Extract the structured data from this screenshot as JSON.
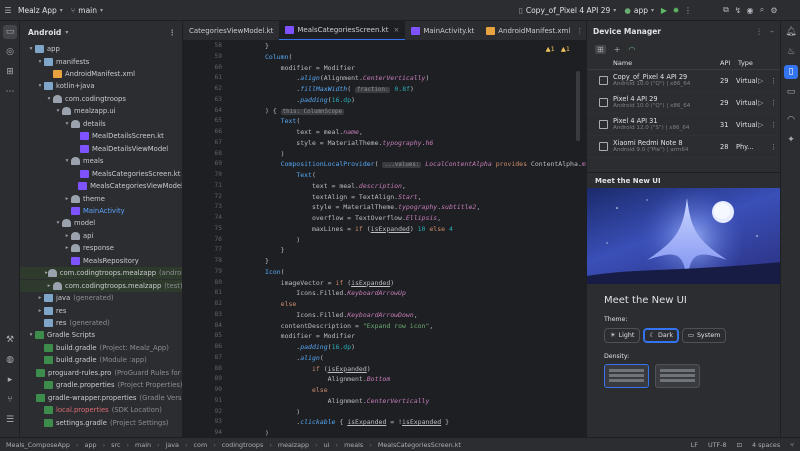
{
  "titlebar": {
    "app_name": "Mealz App",
    "branch": "main",
    "device": "Copy_of_Pixel 4 API 29",
    "run_config": "app"
  },
  "left_strip": {
    "icons": [
      "folder-icon",
      "commit-icon",
      "structure-icon",
      "more-icon",
      "build-icon",
      "problems-icon",
      "terminal-icon",
      "git-icon",
      "logcat-icon"
    ]
  },
  "project": {
    "title": "Android",
    "tree": [
      {
        "label": "app",
        "indent": 1,
        "arrow": "▾",
        "icon": "folder"
      },
      {
        "label": "manifests",
        "indent": 2,
        "arrow": "▾",
        "icon": "folder"
      },
      {
        "label": "AndroidManifest.xml",
        "indent": 3,
        "arrow": "",
        "icon": "xml"
      },
      {
        "label": "kotlin+java",
        "indent": 2,
        "arrow": "▾",
        "icon": "folder"
      },
      {
        "label": "com.codingtroops",
        "indent": 3,
        "arrow": "▾",
        "icon": "pkg"
      },
      {
        "label": "mealzapp.ui",
        "indent": 4,
        "arrow": "▾",
        "icon": "pkg"
      },
      {
        "label": "details",
        "indent": 5,
        "arrow": "▾",
        "icon": "pkg"
      },
      {
        "label": "MealDetailsScreen.kt",
        "indent": 6,
        "arrow": "",
        "icon": "kt"
      },
      {
        "label": "MealDetailsViewModel",
        "indent": 6,
        "arrow": "",
        "icon": "kt"
      },
      {
        "label": "meals",
        "indent": 5,
        "arrow": "▾",
        "icon": "pkg"
      },
      {
        "label": "MealsCategoriesScreen.kt",
        "indent": 6,
        "arrow": "",
        "icon": "kt"
      },
      {
        "label": "MealsCategoriesViewModel",
        "indent": 6,
        "arrow": "",
        "icon": "kt"
      },
      {
        "label": "theme",
        "indent": 5,
        "arrow": "▸",
        "icon": "pkg"
      },
      {
        "label": "MainActivity",
        "indent": 5,
        "arrow": "",
        "icon": "kt",
        "sel": true
      },
      {
        "label": "model",
        "indent": 4,
        "arrow": "▾",
        "icon": "pkg"
      },
      {
        "label": "api",
        "indent": 5,
        "arrow": "▸",
        "icon": "pkg"
      },
      {
        "label": "response",
        "indent": 5,
        "arrow": "▸",
        "icon": "pkg"
      },
      {
        "label": "MealsRepository",
        "indent": 5,
        "arrow": "",
        "icon": "kt"
      },
      {
        "label": "com.codingtroops.mealzapp",
        "suffix": "(androidTe",
        "indent": 3,
        "arrow": "▸",
        "icon": "pkg",
        "hl": true
      },
      {
        "label": "com.codingtroops.mealzapp",
        "suffix": "(test)",
        "indent": 3,
        "arrow": "▸",
        "icon": "pkg",
        "hl": true
      },
      {
        "label": "java",
        "suffix": "(generated)",
        "indent": 2,
        "arrow": "▸",
        "icon": "folder"
      },
      {
        "label": "res",
        "indent": 2,
        "arrow": "▸",
        "icon": "folder"
      },
      {
        "label": "res",
        "suffix": "(generated)",
        "indent": 2,
        "arrow": "",
        "icon": "folder"
      },
      {
        "label": "Gradle Scripts",
        "indent": 1,
        "arrow": "▾",
        "icon": "grd"
      },
      {
        "label": "build.gradle",
        "suffix": "(Project: Mealz_App)",
        "indent": 2,
        "arrow": "",
        "icon": "grd"
      },
      {
        "label": "build.gradle",
        "suffix": "(Module :app)",
        "indent": 2,
        "arrow": "",
        "icon": "grd"
      },
      {
        "label": "proguard-rules.pro",
        "suffix": "(ProGuard Rules for \":ap",
        "indent": 2,
        "arrow": "",
        "icon": "grd"
      },
      {
        "label": "gradle.properties",
        "suffix": "(Project Properties)",
        "indent": 2,
        "arrow": "",
        "icon": "grd"
      },
      {
        "label": "gradle-wrapper.properties",
        "suffix": "(Gradle Version)",
        "indent": 2,
        "arrow": "",
        "icon": "grd"
      },
      {
        "label": "local.properties",
        "suffix": "(SDK Location)",
        "indent": 2,
        "arrow": "",
        "icon": "grd",
        "red": true
      },
      {
        "label": "settings.gradle",
        "suffix": "(Project Settings)",
        "indent": 2,
        "arrow": "",
        "icon": "grd"
      }
    ]
  },
  "tabs": [
    {
      "label": "CategoriesViewModel.kt",
      "active": false
    },
    {
      "label": "MealsCategoriesScreen.kt",
      "active": true
    },
    {
      "label": "MainActivity.kt",
      "active": false
    },
    {
      "label": "AndroidManifest.xml",
      "active": false
    }
  ],
  "editor": {
    "warnings": "1",
    "alerts": "1",
    "line_numbers": [
      "58",
      "59",
      "60",
      "61",
      "62",
      "63",
      "64",
      "65",
      "66",
      "67",
      "68",
      "69",
      "70",
      "71",
      "72",
      "73",
      "74",
      "75",
      "76",
      "77",
      "78",
      "79",
      "80",
      "81",
      "82",
      "83",
      "84",
      "85",
      "86",
      "87",
      "88",
      "89",
      "90",
      "91",
      "92",
      "93",
      "94"
    ],
    "code": [
      "}",
      "Column(",
      "    modifier = Modifier",
      "        .align(Alignment.CenterVertically)",
      "        .fillMaxWidth( fraction: 0.8f)",
      "        .padding(16.dp)",
      ") { this: ColumnScope",
      "    Text(",
      "        text = meal.name,",
      "        style = MaterialTheme.typography.h6",
      "    )",
      "    CompositionLocalProvider( ...values: LocalContentAlpha provides ContentAlpha.medium) {",
      "        Text(",
      "            text = meal.description,",
      "            textAlign = TextAlign.Start,",
      "            style = MaterialTheme.typography.subtitle2,",
      "            overflow = TextOverflow.Ellipsis,",
      "            maxLines = if (isExpanded) 10 else 4",
      "        )",
      "    }",
      "}",
      "Icon(",
      "    imageVector = if (isExpanded)",
      "        Icons.Filled.KeyboardArrowUp",
      "    else",
      "        Icons.Filled.KeyboardArrowDown,",
      "    contentDescription = \"Expand row icon\",",
      "    modifier = Modifier",
      "        .padding(16.dp)",
      "        .align(",
      "            if (isExpanded)",
      "                Alignment.Bottom",
      "            else",
      "                Alignment.CenterVertically",
      "        )",
      "        .clickable { isExpanded = !isExpanded }",
      ")"
    ]
  },
  "device_manager": {
    "title": "Device Manager",
    "col_name": "Name",
    "col_api": "API",
    "col_type": "Type",
    "devices": [
      {
        "name": "Copy_of_Pixel 4 API 29",
        "sub": "Android 10.0 (\"Q\") | x86_64",
        "api": "29",
        "type": "Virtual"
      },
      {
        "name": "Pixel 4 API 29",
        "sub": "Android 10.0 (\"Q\") | x86_64",
        "api": "29",
        "type": "Virtual"
      },
      {
        "name": "Pixel 4 API 31",
        "sub": "Android 12.0 (\"S\") | x86_64",
        "api": "31",
        "type": "Virtual"
      },
      {
        "name": "Xiaomi Redmi Note 8",
        "sub": "Android 9.0 (\"Pie\") | arm64",
        "api": "28",
        "type": "Phy..."
      }
    ]
  },
  "whats_new": {
    "panel_title": "Meet the New UI",
    "heading": "Meet the New UI",
    "theme_label": "Theme:",
    "themes": [
      {
        "label": "Light",
        "on": false
      },
      {
        "label": "Dark",
        "on": true
      },
      {
        "label": "System",
        "on": false
      }
    ],
    "density_label": "Density:"
  },
  "right_strip": {
    "icons": [
      "notifications-icon",
      "gradle-icon",
      "device-manager-icon",
      "emulator-icon",
      "wifi-icon",
      "ai-icon"
    ]
  },
  "statusbar": {
    "crumbs": [
      "Meals_ComposeApp",
      "app",
      "src",
      "main",
      "java",
      "com",
      "codingtroops",
      "mealzapp",
      "ui",
      "meals",
      "MealsCategoriesScreen.kt"
    ],
    "line_sep": "LF",
    "encoding": "UTF-8",
    "indent": "4 spaces"
  }
}
